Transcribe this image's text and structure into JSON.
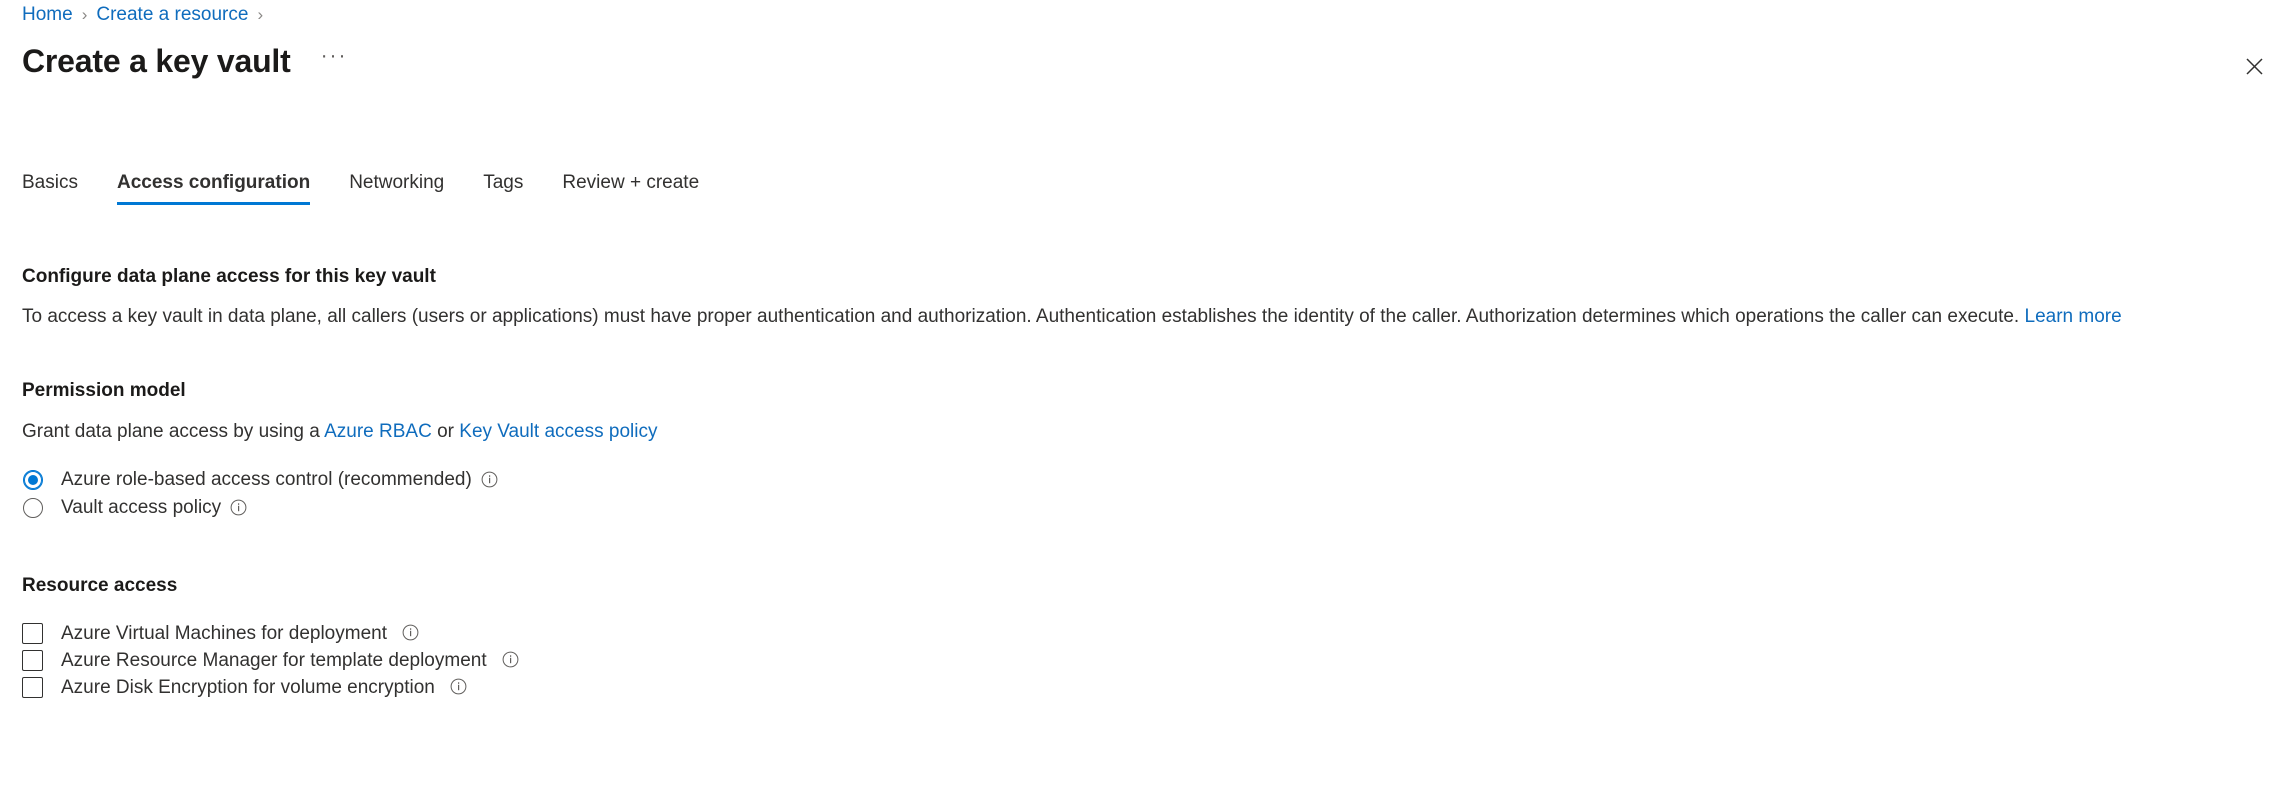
{
  "breadcrumb": {
    "items": [
      {
        "label": "Home"
      },
      {
        "label": "Create a resource"
      }
    ],
    "separator": "›"
  },
  "header": {
    "title": "Create a key vault",
    "ellipsis_label": "···",
    "close_icon": "close-icon"
  },
  "tabs": [
    {
      "label": "Basics",
      "active": false
    },
    {
      "label": "Access configuration",
      "active": true
    },
    {
      "label": "Networking",
      "active": false
    },
    {
      "label": "Tags",
      "active": false
    },
    {
      "label": "Review + create",
      "active": false
    }
  ],
  "main": {
    "section_title": "Configure data plane access for this key vault",
    "description": {
      "text": "To access a key vault in data plane, all callers (users or applications) must have proper authentication and authorization. Authentication establishes the identity of the caller. Authorization determines which operations the caller can execute.",
      "link": "Learn more"
    },
    "permission_model": {
      "heading": "Permission model",
      "grant_prefix": "Grant data plane access by using a",
      "link_rbac": "Azure RBAC",
      "grant_middle": "or",
      "link_policy": "Key Vault access policy",
      "options": [
        {
          "label": "Azure role-based access control (recommended)",
          "checked": true,
          "info": "info-icon"
        },
        {
          "label": "Vault access policy",
          "checked": false,
          "info": "info-icon"
        }
      ]
    },
    "resource_access": {
      "heading": "Resource access",
      "options": [
        {
          "label": "Azure Virtual Machines for deployment",
          "checked": false,
          "info": "info-icon"
        },
        {
          "label": "Azure Resource Manager for template deployment",
          "checked": false,
          "info": "info-icon"
        },
        {
          "label": "Azure Disk Encryption for volume encryption",
          "checked": false,
          "info": "info-icon"
        }
      ]
    }
  },
  "colors": {
    "accent": "#0078d4",
    "link": "#0f6cbd",
    "text": "#323130",
    "title": "#1b1a19",
    "separator": "#8a8886"
  }
}
